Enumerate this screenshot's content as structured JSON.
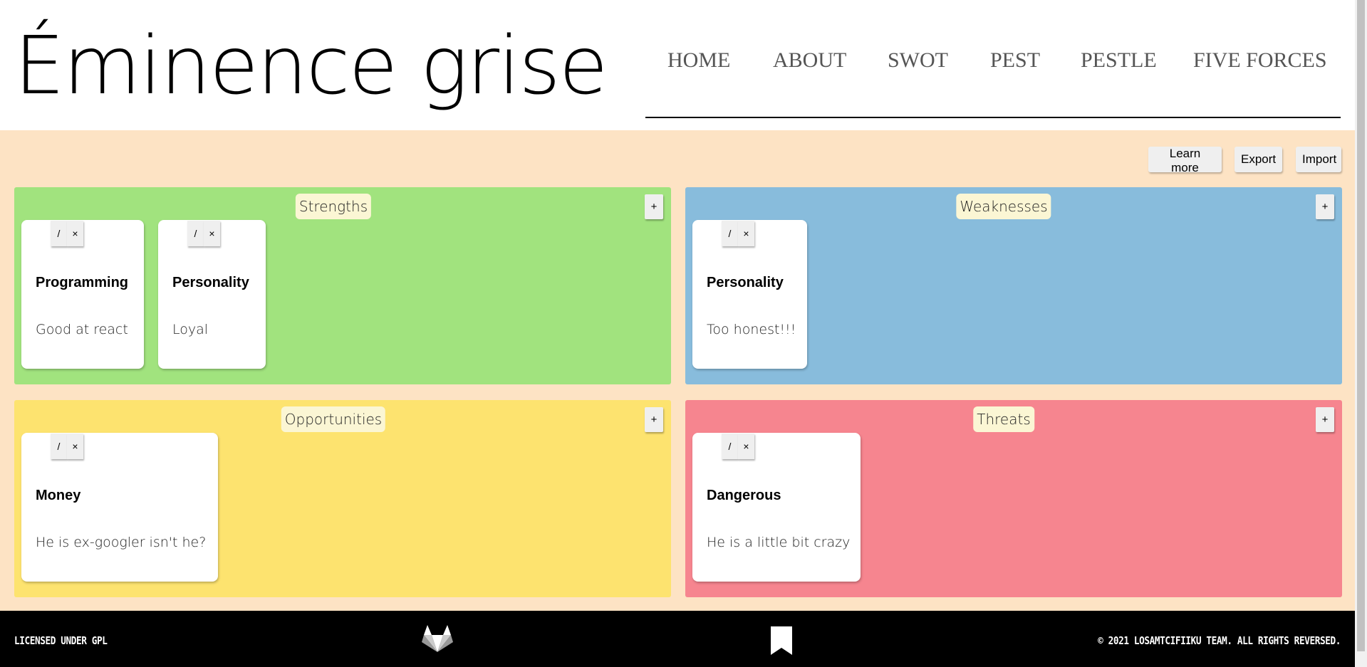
{
  "app": {
    "title": "Éminence grise"
  },
  "nav": {
    "items": [
      "HOME",
      "ABOUT",
      "SWOT",
      "PEST",
      "PESTLE",
      "FIVE FORCES"
    ]
  },
  "toolbar": {
    "learn_more": "Learn more",
    "export": "Export",
    "import": "Import"
  },
  "quadrants": [
    {
      "title": "Strengths",
      "color": "#a1e37e",
      "add_label": "+",
      "cards": [
        {
          "title": "Programming",
          "text": "Good at react"
        },
        {
          "title": "Personality",
          "text": "Loyal"
        }
      ]
    },
    {
      "title": "Weaknesses",
      "color": "#88bcdc",
      "add_label": "+",
      "cards": [
        {
          "title": "Personality",
          "text": "Too honest!!!"
        }
      ]
    },
    {
      "title": "Opportunities",
      "color": "#fde36f",
      "add_label": "+",
      "cards": [
        {
          "title": "Money",
          "text": "He is ex-googler isn't he?"
        }
      ]
    },
    {
      "title": "Threats",
      "color": "#f6858f",
      "add_label": "+",
      "cards": [
        {
          "title": "Dangerous",
          "text": "He is a little bit crazy"
        }
      ]
    }
  ],
  "card_controls": {
    "edit": "/",
    "delete": "×"
  },
  "footer": {
    "license": "LICENSED UNDER GPL",
    "copyright": "© 2021 LOSAMTCIFIIKU TEAM. ALL RIGHTS REVERSED.",
    "icons": [
      "gitlab-icon",
      "bookmark-icon"
    ]
  }
}
